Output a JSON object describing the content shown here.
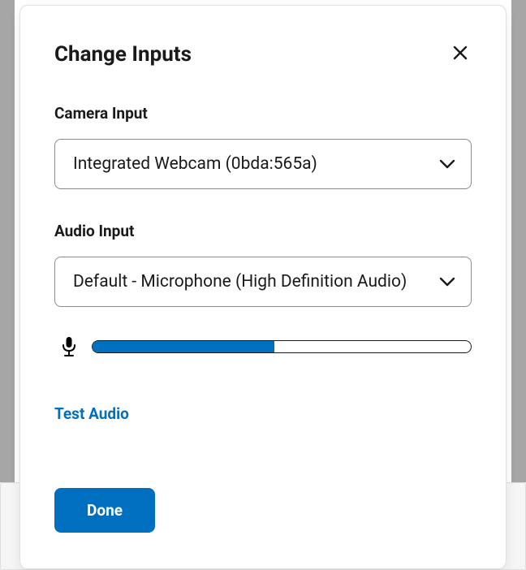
{
  "modal": {
    "title": "Change Inputs",
    "camera": {
      "label": "Camera Input",
      "selected": "Integrated Webcam (0bda:565a)"
    },
    "audio": {
      "label": "Audio Input",
      "selected": "Default - Microphone (High Definition Audio)",
      "level_percent": 48
    },
    "test_audio_label": "Test Audio",
    "done_label": "Done"
  }
}
